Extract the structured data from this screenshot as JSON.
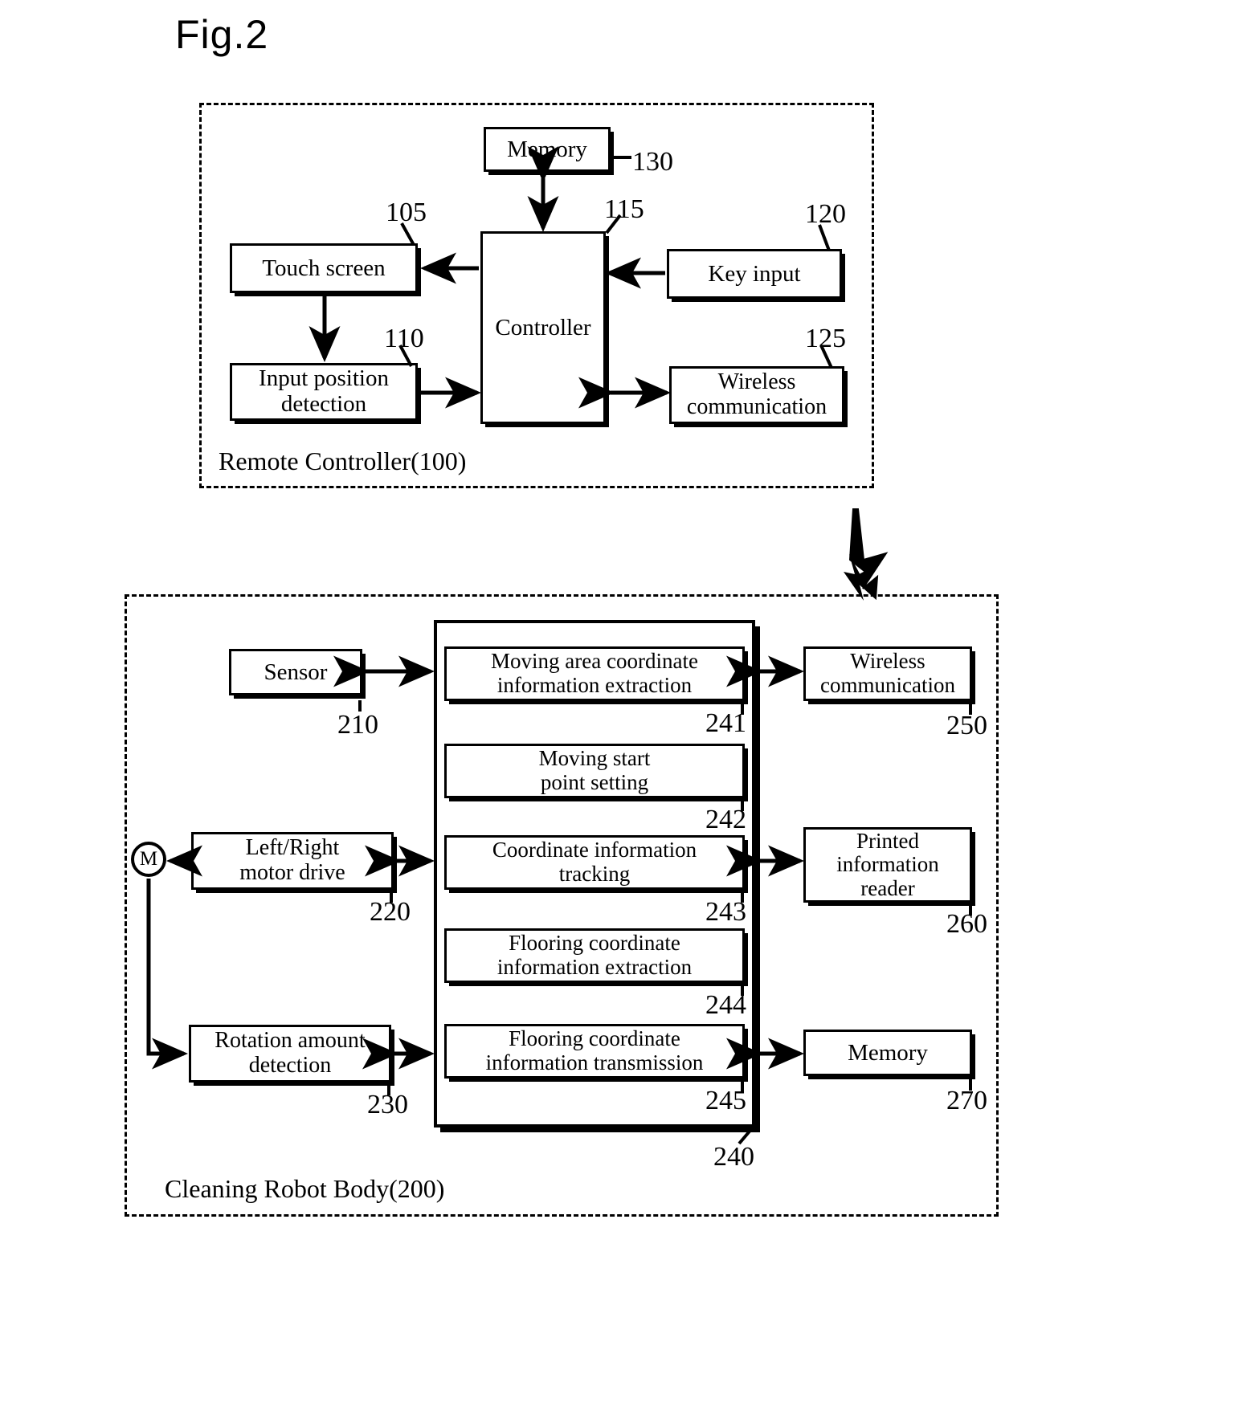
{
  "figure": {
    "title": "Fig.2"
  },
  "remote_controller": {
    "enclosure_label": "Remote Controller(100)",
    "blocks": [
      {
        "label": "Memory",
        "ref": "130"
      },
      {
        "label_line1": "Touch screen",
        "ref": "105"
      },
      {
        "label_line1": "Input position",
        "label_line2": "detection",
        "ref": "110"
      },
      {
        "label_line1": "Controller",
        "ref": "115"
      },
      {
        "label_line1": "Key input",
        "ref": "120"
      },
      {
        "label_line1": "Wireless",
        "label_line2": "communication",
        "ref": "125"
      }
    ],
    "memory_label": "Memory",
    "memory_ref": "130",
    "touch_screen_label": "Touch screen",
    "touch_screen_ref": "105",
    "input_position_l1": "Input position",
    "input_position_l2": "detection",
    "input_position_ref": "110",
    "controller_label": "Controller",
    "controller_ref": "115",
    "key_input_label": "Key input",
    "key_input_ref": "120",
    "wireless_l1": "Wireless",
    "wireless_l2": "communication",
    "wireless_ref": "125"
  },
  "robot_body": {
    "enclosure_label": "Cleaning Robot Body(200)",
    "sensor_label": "Sensor",
    "sensor_ref": "210",
    "motor_drive_l1": "Left/Right",
    "motor_drive_l2": "motor drive",
    "motor_drive_ref": "220",
    "motor_symbol": "M",
    "rotation_l1": "Rotation amount",
    "rotation_l2": "detection",
    "rotation_ref": "230",
    "processor_ref": "240",
    "proc_items": [
      {
        "line1": "Moving area coordinate",
        "line2": "information extraction",
        "ref": "241"
      },
      {
        "line1": "Moving start",
        "line2": "point setting",
        "ref": "242"
      },
      {
        "line1": "Coordinate information",
        "line2": "tracking",
        "ref": "243"
      },
      {
        "line1": "Flooring coordinate",
        "line2": "information extraction",
        "ref": "244"
      },
      {
        "line1": "Flooring coordinate",
        "line2": "information transmission",
        "ref": "245"
      }
    ],
    "proc_241_l1": "Moving area coordinate",
    "proc_241_l2": "information extraction",
    "proc_241_ref": "241",
    "proc_242_l1": "Moving start",
    "proc_242_l2": "point setting",
    "proc_242_ref": "242",
    "proc_243_l1": "Coordinate information",
    "proc_243_l2": "tracking",
    "proc_243_ref": "243",
    "proc_244_l1": "Flooring coordinate",
    "proc_244_l2": "information extraction",
    "proc_244_ref": "244",
    "proc_245_l1": "Flooring coordinate",
    "proc_245_l2": "information transmission",
    "proc_245_ref": "245",
    "wireless_l1": "Wireless",
    "wireless_l2": "communication",
    "wireless_ref": "250",
    "printed_l1": "Printed",
    "printed_l2": "information",
    "printed_l3": "reader",
    "printed_ref": "260",
    "memory_label": "Memory",
    "memory_ref": "270"
  },
  "colors": {
    "ink": "#000000",
    "paper": "#ffffff"
  }
}
